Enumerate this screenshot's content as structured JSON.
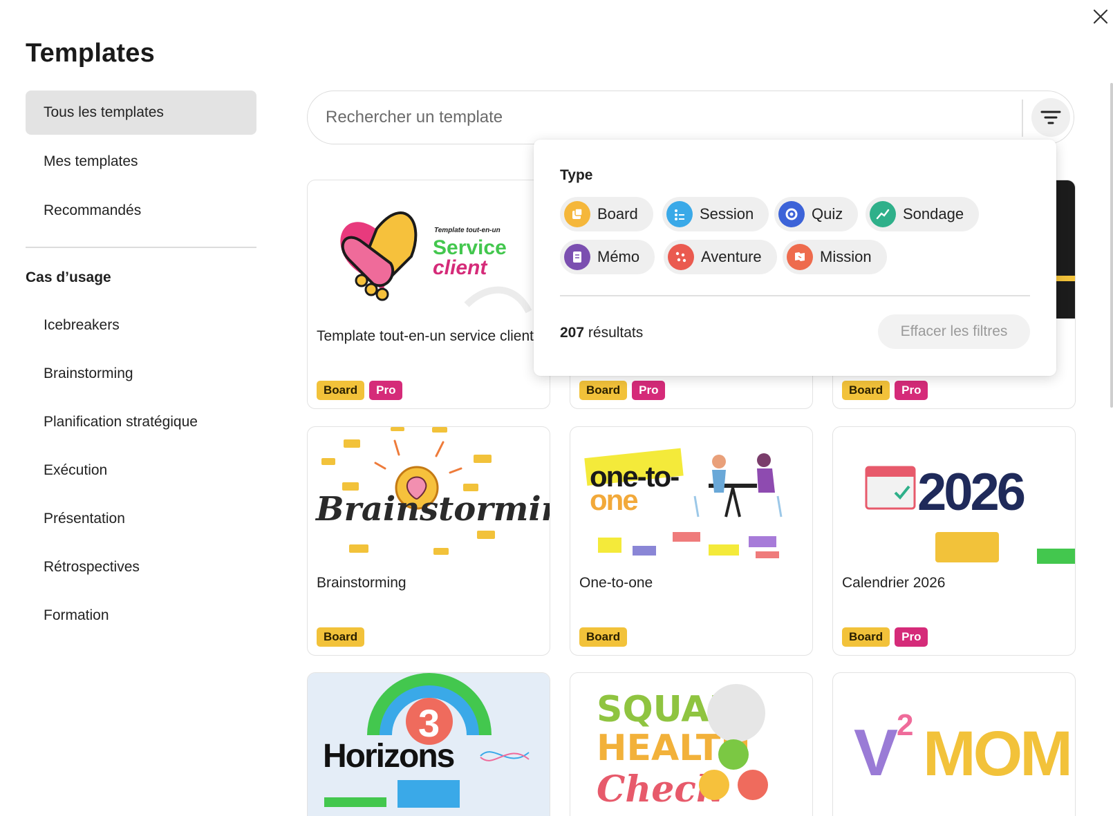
{
  "page": {
    "title": "Templates"
  },
  "sidebar": {
    "main_items": [
      {
        "label": "Tous les templates"
      },
      {
        "label": "Mes templates"
      },
      {
        "label": "Recommandés"
      }
    ],
    "section_title": "Cas d’usage",
    "usecases": [
      {
        "label": "Icebreakers"
      },
      {
        "label": "Brainstorming"
      },
      {
        "label": "Planification stratégique"
      },
      {
        "label": "Exécution"
      },
      {
        "label": "Présentation"
      },
      {
        "label": "Rétrospectives"
      },
      {
        "label": "Formation"
      }
    ]
  },
  "search": {
    "placeholder": "Rechercher un template",
    "value": ""
  },
  "filter": {
    "type_label": "Type",
    "types": [
      {
        "label": "Board",
        "icon": "board-icon",
        "color": "#f5b73b"
      },
      {
        "label": "Session",
        "icon": "session-icon",
        "color": "#3aa9e8"
      },
      {
        "label": "Quiz",
        "icon": "quiz-icon",
        "color": "#3c63d8"
      },
      {
        "label": "Sondage",
        "icon": "sondage-icon",
        "color": "#2fb08a"
      },
      {
        "label": "Mémo",
        "icon": "memo-icon",
        "color": "#7b4fb0"
      },
      {
        "label": "Aventure",
        "icon": "aventure-icon",
        "color": "#ea5a4f"
      },
      {
        "label": "Mission",
        "icon": "mission-icon",
        "color": "#ee6b4d"
      }
    ],
    "results_count": "207",
    "results_label": "résultats",
    "clear_label": "Effacer les filtres"
  },
  "tags": {
    "board": "Board",
    "pro": "Pro"
  },
  "templates": [
    {
      "title": "Template tout-en-un service client",
      "thumb_heading": "Template tout-en-un",
      "thumb_line1": "Service",
      "thumb_line2": "client"
    },
    {
      "title": ""
    },
    {
      "title": ""
    },
    {
      "title": "Brainstorming",
      "thumb_text": "Brainstorming"
    },
    {
      "title": "One-to-one",
      "thumb_line1": "one-to-",
      "thumb_line2": "one"
    },
    {
      "title": "Calendrier 2026",
      "thumb_text": "2026"
    },
    {
      "title": "",
      "thumb_line1": "3",
      "thumb_line2": "Horizons"
    },
    {
      "title": "",
      "thumb_line1": "SQUAD",
      "thumb_line2": "HEALTH",
      "thumb_line3": "Check"
    },
    {
      "title": "",
      "thumb_line1": "V",
      "thumb_line2": "2",
      "thumb_line3": "MOM"
    }
  ]
}
